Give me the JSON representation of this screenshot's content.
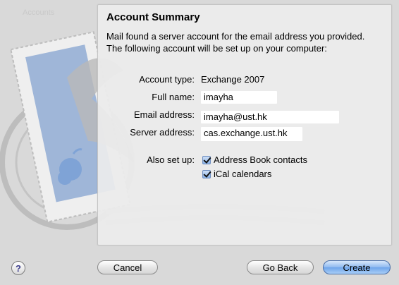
{
  "panel": {
    "title": "Account Summary",
    "description": "Mail found a server account for the email address you provided.  The following account will be set up on your computer:"
  },
  "summary": {
    "account_type_label": "Account type:",
    "account_type_value": "Exchange 2007",
    "full_name_label": "Full name:",
    "full_name_value": "imayha",
    "email_label": "Email address:",
    "email_value": "imayha@ust.hk",
    "server_label": "Server address:",
    "server_value": "cas.exchange.ust.hk",
    "also_setup_label": "Also set up:",
    "options": [
      {
        "label": "Address Book contacts",
        "checked": true
      },
      {
        "label": "iCal calendars",
        "checked": true
      }
    ]
  },
  "buttons": {
    "help": "?",
    "cancel": "Cancel",
    "go_back": "Go Back",
    "create": "Create"
  },
  "colors": {
    "accent": "#6ea4ea",
    "panel_bg": "#ececec"
  }
}
